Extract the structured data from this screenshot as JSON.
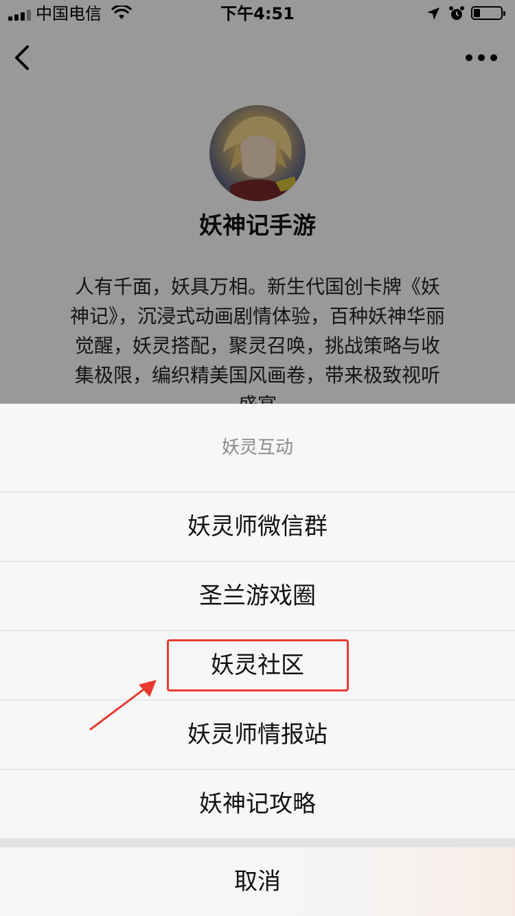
{
  "status_bar": {
    "carrier": "中国电信",
    "time": "下午4:51"
  },
  "profile": {
    "name": "妖神记手游",
    "description": "人有千面，妖具万相。新生代国创卡牌《妖神记》，沉浸式动画剧情体验，百种妖神华丽觉醒，妖灵搭配，聚灵召唤，挑战策略与收集极限，编织精美国风画卷，带来极致视听盛宴"
  },
  "action_sheet": {
    "title": "妖灵互动",
    "items": [
      {
        "label": "妖灵师微信群"
      },
      {
        "label": "圣兰游戏圈"
      },
      {
        "label": "妖灵社区"
      },
      {
        "label": "妖灵师情报站"
      },
      {
        "label": "妖神记攻略"
      }
    ],
    "cancel_label": "取消"
  },
  "annotation": {
    "color": "#e83a2f",
    "highlighted_item": "妖灵社区"
  },
  "icons": {
    "back": "chevron-left-icon",
    "more": "more-dots-icon",
    "wifi": "wifi-icon",
    "location": "location-arrow-icon",
    "alarm": "alarm-icon",
    "battery": "battery-icon"
  }
}
